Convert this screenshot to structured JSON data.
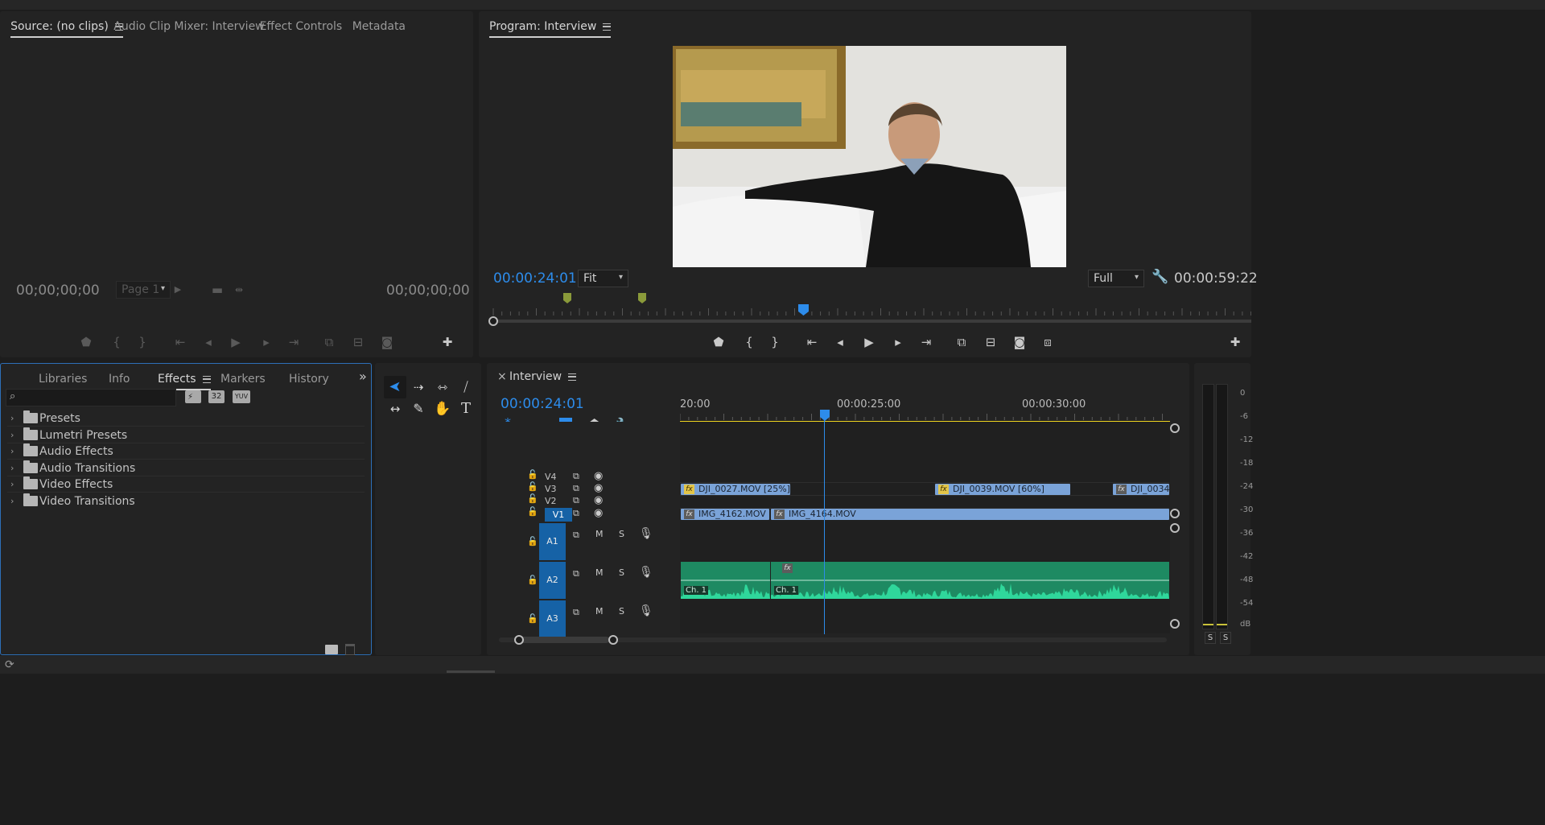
{
  "source_panel": {
    "tabs": [
      "Source: (no clips)",
      "Audio Clip Mixer: Interview",
      "Effect Controls",
      "Metadata"
    ],
    "timecode_left": "00;00;00;00",
    "timecode_right": "00;00;00;00",
    "page_dropdown": "Page 1"
  },
  "program_panel": {
    "title": "Program: Interview",
    "timecode_current": "00:00:24:01",
    "fit_dropdown": "Fit",
    "full_dropdown": "Full",
    "timecode_duration": "00:00:59:22",
    "playhead_fraction": 0.41
  },
  "effects_panel": {
    "tabs": [
      "Libraries",
      "Info",
      "Effects",
      "Markers",
      "History"
    ],
    "search_placeholder": "",
    "filter_buttons": [
      "32",
      "YUV"
    ],
    "tree": [
      "Presets",
      "Lumetri Presets",
      "Audio Effects",
      "Audio Transitions",
      "Video Effects",
      "Video Transitions"
    ]
  },
  "timeline": {
    "tab_close": "×",
    "title": "Interview",
    "timecode": "00:00:24:01",
    "ruler_labels": [
      "20:00",
      "00:00:25:00",
      "00:00:30:00"
    ],
    "video_tracks": [
      "V4",
      "V3",
      "V2",
      "V1"
    ],
    "audio_tracks": [
      "A1",
      "A2",
      "A3"
    ],
    "audio_buttons": [
      "M",
      "S"
    ],
    "clips_v3": [
      "DJI_0027.MOV [25%]",
      "DJI_0039.MOV [60%]",
      "DJI_0034."
    ],
    "clips_v1": [
      "IMG_4162.MOV",
      "IMG_4164.MOV"
    ],
    "audio_channel_labels": [
      "Ch. 1",
      "Ch. 1"
    ]
  },
  "audio_meter": {
    "scale": [
      "0",
      "-6",
      "-12",
      "-18",
      "-24",
      "-30",
      "-36",
      "-42",
      "-48",
      "-54",
      "dB"
    ],
    "solo_buttons": [
      "S",
      "S"
    ]
  },
  "colors": {
    "accent_blue": "#2d8ceb",
    "clip_video": "#7aa3d8",
    "clip_audio": "#1e8a62",
    "waveform": "#2fd79b",
    "work_area": "#ecd21f",
    "marker_green": "#8a9a3a"
  }
}
